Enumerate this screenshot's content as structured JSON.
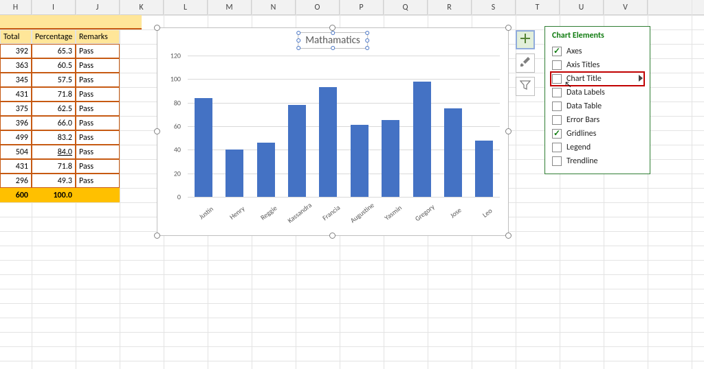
{
  "columns": [
    "H",
    "I",
    "J",
    "K",
    "L",
    "M",
    "N",
    "O",
    "P",
    "Q",
    "R",
    "S",
    "T",
    "U",
    "V"
  ],
  "table": {
    "headers": [
      "Total",
      "Percentage",
      "Remarks"
    ],
    "rows": [
      {
        "total": "392",
        "pct": "65.3",
        "rem": "Pass"
      },
      {
        "total": "363",
        "pct": "60.5",
        "rem": "Pass"
      },
      {
        "total": "345",
        "pct": "57.5",
        "rem": "Pass"
      },
      {
        "total": "431",
        "pct": "71.8",
        "rem": "Pass"
      },
      {
        "total": "375",
        "pct": "62.5",
        "rem": "Pass"
      },
      {
        "total": "396",
        "pct": "66.0",
        "rem": "Pass"
      },
      {
        "total": "499",
        "pct": "83.2",
        "rem": "Pass"
      },
      {
        "total": "504",
        "pct": "84.0",
        "rem": "Pass",
        "pct_underline": true
      },
      {
        "total": "431",
        "pct": "71.8",
        "rem": "Pass"
      },
      {
        "total": "296",
        "pct": "49.3",
        "rem": "Pass"
      }
    ],
    "footer": {
      "total": "600",
      "pct": "100.0",
      "rem": ""
    }
  },
  "chart_data": {
    "type": "bar",
    "title": "Mathamatics",
    "categories": [
      "Justin",
      "Henry",
      "Reggie",
      "Kassandra",
      "Francia",
      "Augustine",
      "Yasmin",
      "Gregory",
      "Jose",
      "Leo"
    ],
    "values": [
      84,
      40,
      46,
      78,
      93,
      61,
      65,
      98,
      75,
      48
    ],
    "ylim": [
      0,
      120
    ],
    "yticks": [
      0,
      20,
      40,
      60,
      80,
      100,
      120
    ],
    "xlabel": "",
    "ylabel": ""
  },
  "flyout": {
    "title": "Chart Elements",
    "items": [
      {
        "label": "Axes",
        "checked": true
      },
      {
        "label": "Axis Titles",
        "checked": false
      },
      {
        "label": "Chart Title",
        "checked": false,
        "highlight": true,
        "submenu": true
      },
      {
        "label": "Data Labels",
        "checked": false
      },
      {
        "label": "Data Table",
        "checked": false
      },
      {
        "label": "Error Bars",
        "checked": false
      },
      {
        "label": "Gridlines",
        "checked": true
      },
      {
        "label": "Legend",
        "checked": false
      },
      {
        "label": "Trendline",
        "checked": false
      }
    ]
  }
}
